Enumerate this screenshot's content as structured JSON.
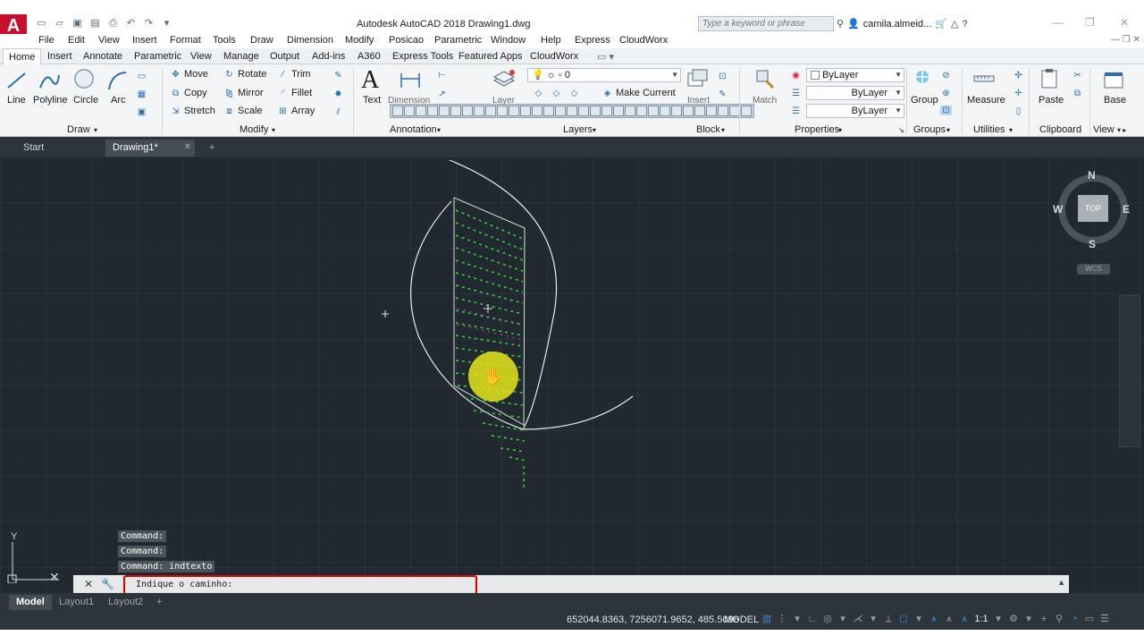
{
  "window": {
    "title": "Autodesk AutoCAD 2018   Drawing1.dwg",
    "search_placeholder": "Type a keyword or phrase",
    "user": "camila.almeid...",
    "logo": "A"
  },
  "menu": [
    "File",
    "Edit",
    "View",
    "Insert",
    "Format",
    "Tools",
    "Draw",
    "Dimension",
    "Modify",
    "Posicao",
    "Parametric",
    "Window",
    "Help",
    "Express",
    "CloudWorx"
  ],
  "ribbon_tabs": [
    "Home",
    "Insert",
    "Annotate",
    "Parametric",
    "View",
    "Manage",
    "Output",
    "Add-ins",
    "A360",
    "Express Tools",
    "Featured Apps",
    "CloudWorx"
  ],
  "ribbon": {
    "draw": {
      "line": "Line",
      "polyline": "Polyline",
      "circle": "Circle",
      "arc": "Arc",
      "label": "Draw"
    },
    "modify": {
      "move": "Move",
      "rotate": "Rotate",
      "trim": "Trim",
      "copy": "Copy",
      "mirror": "Mirror",
      "fillet": "Fillet",
      "stretch": "Stretch",
      "scale": "Scale",
      "array": "Array",
      "label": "Modify"
    },
    "annotation": {
      "text": "Text",
      "dimension": "Dimension",
      "label": "Annotation"
    },
    "layers": {
      "current_layer": "0",
      "make_current": "Make Current",
      "layer": "Layer",
      "label": "Layers"
    },
    "block": {
      "insert": "Insert",
      "label": "Block"
    },
    "properties": {
      "match": "Match",
      "color": "ByLayer",
      "linetype": "ByLayer",
      "lineweight": "ByLayer",
      "label": "Properties"
    },
    "groups": {
      "group": "Group",
      "label": "Groups"
    },
    "utilities": {
      "measure": "Measure",
      "label": "Utilities"
    },
    "clipboard": {
      "paste": "Paste",
      "label": "Clipboard"
    },
    "view": {
      "base": "Base",
      "label": "View"
    }
  },
  "file_tabs": {
    "start": "Start",
    "drawing": "Drawing1*"
  },
  "viewcube": {
    "n": "N",
    "s": "S",
    "e": "E",
    "w": "W",
    "top": "TOP",
    "wcs": "WCS"
  },
  "ucs": {
    "y": "Y"
  },
  "command": {
    "history": [
      "Command:",
      "Command:",
      "Command:  indtexto"
    ],
    "prompt": "Indique o caminho:"
  },
  "layout_tabs": [
    "Model",
    "Layout1",
    "Layout2"
  ],
  "status": {
    "coordinates": "652044.8363, 7256071.9652, 485.5096",
    "space": "MODEL",
    "scale": "1:1"
  }
}
